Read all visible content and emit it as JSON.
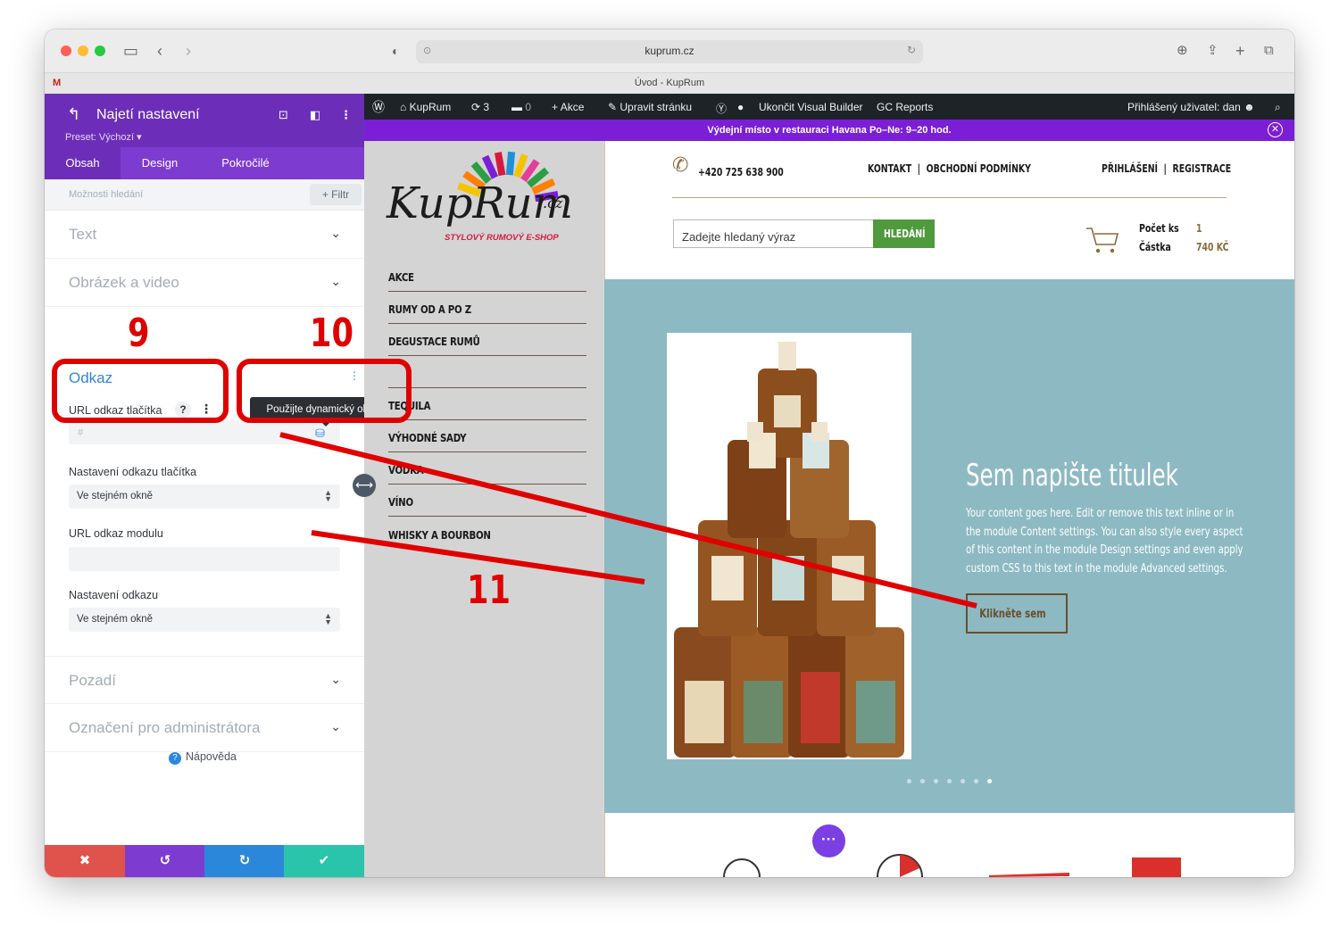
{
  "browser": {
    "url": "kuprum.cz",
    "tab_title": "Úvod - KupRum",
    "gmail_label": "M"
  },
  "panel": {
    "title": "Najetí nastavení",
    "preset": "Preset: Výchozí ▾",
    "tabs": [
      {
        "label": "Obsah",
        "active": true
      },
      {
        "label": "Design",
        "active": false
      },
      {
        "label": "Pokročilé",
        "active": false
      }
    ],
    "search_placeholder": "Možnosti hledání",
    "filter_label": "+ Filtr",
    "sections_top": [
      {
        "label": "Text"
      },
      {
        "label": "Obrázek a video"
      }
    ],
    "link_section": {
      "title": "Odkaz",
      "button_url_label": "URL odkaz tlačítka",
      "button_url_placeholder": "#",
      "dynamic_tooltip": "Použijte dynamický obsah",
      "button_link_target_label": "Nastavení odkazu tlačítka",
      "button_link_target_value": "Ve stejném okně",
      "module_url_label": "URL odkaz modulu",
      "module_link_target_label": "Nastavení odkazu",
      "module_link_target_value": "Ve stejném okně"
    },
    "sections_bottom": [
      {
        "label": "Pozadí"
      },
      {
        "label": "Označení pro administrátora"
      }
    ],
    "help_label": "Nápověda",
    "footer": {
      "cancel": "✖",
      "undo": "↺",
      "redo": "↻",
      "save": "✔",
      "colors": {
        "cancel": "#e0534c",
        "undo": "#7e3bd0",
        "redo": "#2b87da",
        "save": "#29c4a9"
      }
    }
  },
  "admin_bar": {
    "site": "KupRum",
    "updates": "3",
    "comments": "0",
    "new": "Akce",
    "edit": "Upravit stránku",
    "exit_builder": "Ukončit Visual Builder",
    "reports": "GC Reports",
    "user": "Přihlášený uživatel: dan"
  },
  "notice": {
    "text": "Výdejní místo v restauraci Havana Po–Ne: 9–20 hod."
  },
  "site": {
    "logo": "KupRum",
    "logo_tld": ".cz",
    "logo_tagline": "STYLOVÝ RUMOVÝ E-SHOP",
    "menu": [
      "AKCE",
      "RUMY OD A PO Z",
      "DEGUSTACE RUMŮ",
      "",
      "TEQUILA",
      "VÝHODNÉ SADY",
      "VODKA",
      "VÍNO",
      "WHISKY A BOURBON"
    ],
    "phone": "+420 725 638 900",
    "links_left": "KONTAKT  |  OBCHODNÍ PODMÍNKY",
    "links_right": "PŘIHLÁŠENÍ  |  REGISTRACE",
    "search_placeholder": "Zadejte hledaný výraz",
    "search_button": "HLEDÁNÍ",
    "cart_count_label": "Počet ks",
    "cart_count": "1",
    "cart_total_label": "Částka",
    "cart_total": "740 KČ"
  },
  "slide": {
    "title": "Sem napište titulek",
    "body": "Your content goes here. Edit or remove this text inline or in the module Content settings. You can also style every aspect of this content in the module Design settings and even apply custom CSS to this text in the module Advanced settings.",
    "button": "Klikněte sem",
    "dot_count": 7,
    "active_dot": 7
  },
  "annotations": {
    "n9": "9",
    "n10": "10",
    "n11": "11",
    "color": "#e00000"
  }
}
